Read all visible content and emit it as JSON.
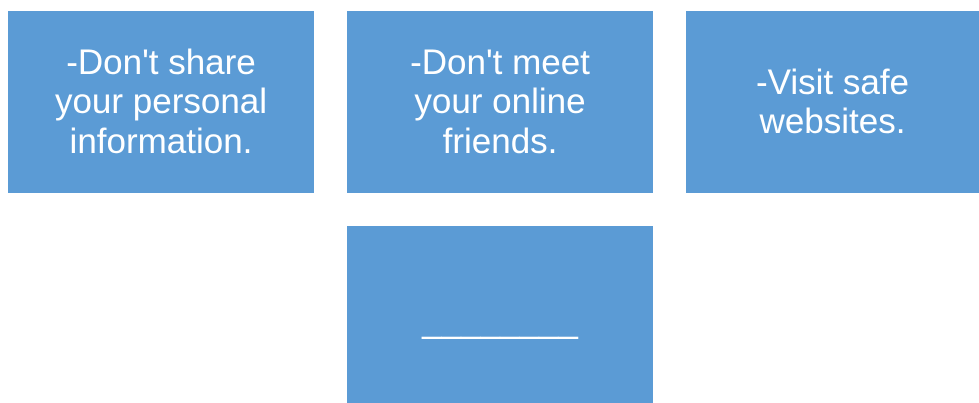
{
  "colors": {
    "card_fill": "#5b9bd5",
    "card_text": "#ffffff",
    "background": "#ffffff"
  },
  "cards": [
    {
      "text": "-Don't share\nyour personal\ninformation."
    },
    {
      "text": "-Don't meet\nyour online\nfriends."
    },
    {
      "text": "-Visit safe\nwebsites."
    },
    {
      "text": "________"
    }
  ]
}
